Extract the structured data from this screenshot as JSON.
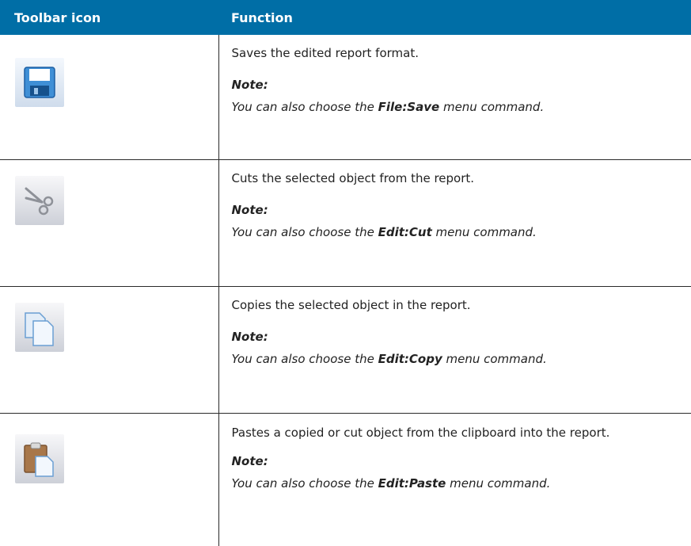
{
  "header": {
    "col1": "Toolbar icon",
    "col2": "Function"
  },
  "rows": [
    {
      "icon": "save-disk-icon",
      "description": "Saves the edited report format.",
      "note_label": "Note:",
      "note_prefix": "You can also choose the ",
      "note_command": "File:Save",
      "note_suffix": " menu command."
    },
    {
      "icon": "scissors-icon",
      "description": "Cuts the selected object from the report.",
      "note_label": "Note:",
      "note_prefix": "You can also choose the ",
      "note_command": "Edit:Cut",
      "note_suffix": " menu command."
    },
    {
      "icon": "copy-pages-icon",
      "description": "Copies the selected object in the report.",
      "note_label": "Note:",
      "note_prefix": "You can also choose the ",
      "note_command": "Edit:Copy",
      "note_suffix": " menu command."
    },
    {
      "icon": "paste-clipboard-icon",
      "description": "Pastes a copied or cut object from the clipboard into the report.",
      "note_label": "Note:",
      "note_prefix": "You can also choose the ",
      "note_command": "Edit:Paste",
      "note_suffix": " menu command."
    }
  ],
  "colors": {
    "header_bg": "#006ea6",
    "header_text": "#ffffff",
    "border": "#2a2a2a"
  }
}
